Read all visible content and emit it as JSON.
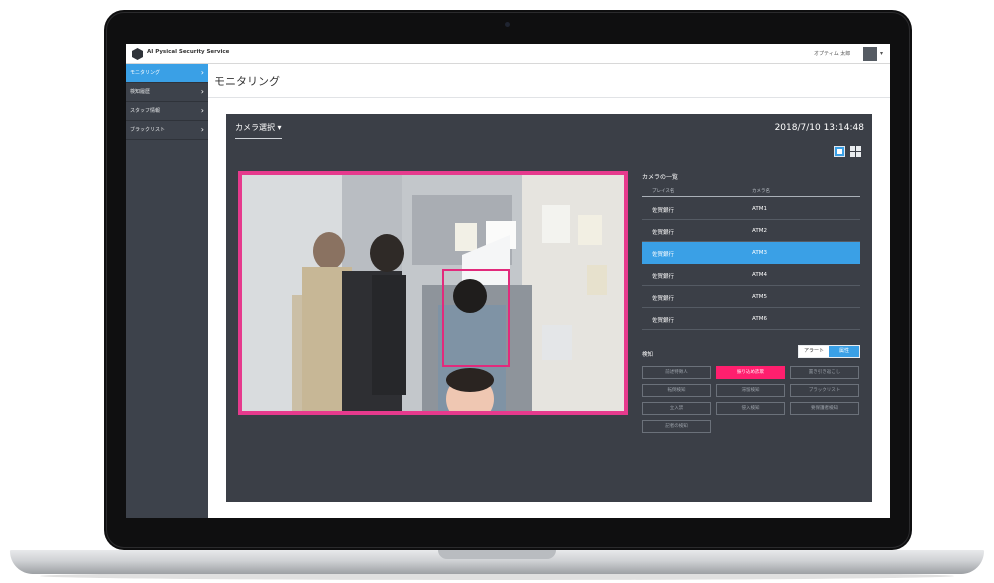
{
  "app": {
    "title": "AI Pysical Security Service"
  },
  "user": {
    "name": "オプティム 太郎",
    "caret": "▾"
  },
  "sidebar": {
    "items": [
      {
        "label": "モニタリング",
        "chevron": "›"
      },
      {
        "label": "検知履歴",
        "chevron": "›"
      },
      {
        "label": "スタッフ情報",
        "chevron": "›"
      },
      {
        "label": "ブラックリスト",
        "chevron": "›"
      }
    ]
  },
  "page": {
    "title": "モニタリング"
  },
  "camera_select": {
    "label": "カメラ選択 ▾"
  },
  "datetime": "2018/7/10 13:14:48",
  "camera_list": {
    "title": "カメラの一覧",
    "headers": {
      "place": "プレイス名",
      "camera": "カメラ名"
    },
    "rows": [
      {
        "place": "佐賀銀行",
        "camera": "ATM1"
      },
      {
        "place": "佐賀銀行",
        "camera": "ATM2"
      },
      {
        "place": "佐賀銀行",
        "camera": "ATM3"
      },
      {
        "place": "佐賀銀行",
        "camera": "ATM4"
      },
      {
        "place": "佐賀銀行",
        "camera": "ATM5"
      },
      {
        "place": "佐賀銀行",
        "camera": "ATM6"
      }
    ],
    "selected_index": 2
  },
  "detection": {
    "label": "検知",
    "toggle": {
      "left": "アラート",
      "right": "属性"
    },
    "buttons": [
      {
        "label": "前述特徴人",
        "active": false
      },
      {
        "label": "振り込め詐欺",
        "active": true
      },
      {
        "label": "置き引き返こし",
        "active": false
      },
      {
        "label": "転倒検知",
        "active": false
      },
      {
        "label": "滞留検知",
        "active": false
      },
      {
        "label": "ブラックリスト",
        "active": false
      },
      {
        "label": "立入禁",
        "active": false
      },
      {
        "label": "侵入検知",
        "active": false
      },
      {
        "label": "要保護者検知",
        "active": false
      },
      {
        "label": "記者の検知",
        "active": false
      }
    ]
  },
  "colors": {
    "accent": "#3aa0e6",
    "alert": "#ff1f6e",
    "panel": "#3b3f47",
    "sidebar": "#3d424b"
  }
}
